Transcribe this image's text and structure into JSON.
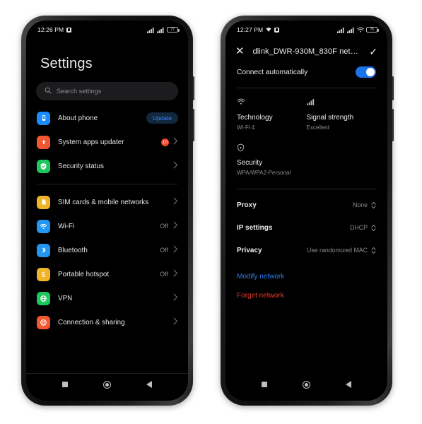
{
  "left_phone": {
    "status_bar": {
      "time": "12:26 PM",
      "alarm_icon": "alarm-square-icon",
      "signal1_icon": "cellular-signal-icon",
      "signal2_icon": "cellular-signal-icon",
      "battery_level": "77",
      "battery_icon": "battery-icon"
    },
    "page_title": "Settings",
    "search": {
      "placeholder": "Search settings",
      "icon": "search-icon"
    },
    "groups": [
      {
        "items": [
          {
            "label": "About phone",
            "icon": "phone-info-icon",
            "icon_color": "#1a8cff",
            "glyph": "☰",
            "badge_pill": "Update",
            "value": "",
            "chevron": false
          },
          {
            "label": "System apps updater",
            "icon": "system-update-icon",
            "icon_color": "#f2572f",
            "glyph": "↑",
            "badge_count": "10",
            "value": "",
            "chevron": true
          },
          {
            "label": "Security status",
            "icon": "security-check-icon",
            "icon_color": "#1dc75b",
            "glyph": "✓",
            "value": "",
            "chevron": true
          }
        ]
      },
      {
        "items": [
          {
            "label": "SIM cards & mobile networks",
            "icon": "sim-card-icon",
            "icon_color": "#f0b429",
            "glyph": "▢",
            "value": "",
            "chevron": true
          },
          {
            "label": "Wi-Fi",
            "icon": "wifi-icon",
            "icon_color": "#2196f3",
            "glyph": "◠",
            "value": "Off",
            "chevron": true
          },
          {
            "label": "Bluetooth",
            "icon": "bluetooth-icon",
            "icon_color": "#2196f3",
            "glyph": "ᛦ",
            "value": "Off",
            "chevron": true
          },
          {
            "label": "Portable hotspot",
            "icon": "hotspot-icon",
            "icon_color": "#f0b429",
            "glyph": "ʃ",
            "value": "Off",
            "chevron": true
          },
          {
            "label": "VPN",
            "icon": "vpn-globe-icon",
            "icon_color": "#1dc75b",
            "glyph": "⊕",
            "value": "",
            "chevron": true
          },
          {
            "label": "Connection & sharing",
            "icon": "connection-sharing-icon",
            "icon_color": "#f2572f",
            "glyph": "@",
            "value": "",
            "chevron": true
          }
        ]
      }
    ],
    "navbar": {
      "recents": "recents-square-icon",
      "home": "home-circle-icon",
      "back": "back-triangle-icon"
    }
  },
  "right_phone": {
    "status_bar": {
      "time": "12:27 PM",
      "wifi_status_icon": "wifi-icon",
      "alarm_icon": "alarm-square-icon",
      "signal1_icon": "cellular-signal-icon",
      "signal2_icon": "cellular-signal-icon",
      "wifi_icon": "wifi-icon",
      "battery_level": "76",
      "battery_icon": "battery-icon"
    },
    "header": {
      "close_label": "✕",
      "network_name": "dlink_DWR-930M_830F net…",
      "confirm_label": "✓"
    },
    "connect_automatically": {
      "label": "Connect automatically",
      "state": "on"
    },
    "info_cells": [
      {
        "icon": "wifi-icon",
        "glyph": "◠",
        "title": "Technology",
        "value": "Wi-Fi 4"
      },
      {
        "icon": "signal-bars-icon",
        "glyph": "▂",
        "title": "Signal strength",
        "value": "Excellent"
      },
      {
        "icon": "shield-icon",
        "glyph": "⛨",
        "title": "Security",
        "value": "WPA/WPA2-Personal"
      }
    ],
    "settings_rows": [
      {
        "label": "Proxy",
        "value": "None"
      },
      {
        "label": "IP settings",
        "value": "DHCP"
      },
      {
        "label": "Privacy",
        "value": "Use randomized MAC"
      }
    ],
    "actions": [
      {
        "label": "Modify network",
        "color": "#2a7cf0"
      },
      {
        "label": "Forget network",
        "color": "#e8392b"
      }
    ],
    "navbar": {
      "recents": "recents-square-icon",
      "home": "home-circle-icon",
      "back": "back-triangle-icon"
    }
  }
}
